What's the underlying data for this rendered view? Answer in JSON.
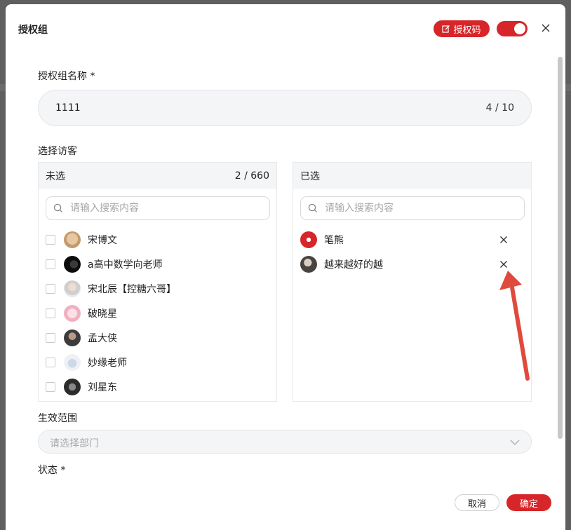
{
  "colors": {
    "accent": "#d6262a",
    "arrow": "#e04a3c"
  },
  "dialog": {
    "title": "授权组",
    "code_button_label": "授权码",
    "toggle_on": true
  },
  "form": {
    "name_label": "授权组名称 *",
    "name_value": "1111",
    "name_count": "4 / 10",
    "visitor_label": "选择访客",
    "scope_label": "生效范围",
    "scope_placeholder": "请选择部门",
    "status_label": "状态 *"
  },
  "unselected": {
    "title": "未选",
    "count": "2 / 660",
    "search_placeholder": "请输入搜索内容",
    "items": [
      {
        "name": "宋博文",
        "avatar": "bear-avatar"
      },
      {
        "name": "a高中数学向老师",
        "avatar": "dark-avatar"
      },
      {
        "name": "宋北辰【控糖六哥】",
        "avatar": "man-avatar"
      },
      {
        "name": "破晓星",
        "avatar": "pink-character-avatar"
      },
      {
        "name": "孟大侠",
        "avatar": "man-avatar"
      },
      {
        "name": "妙缘老师",
        "avatar": "statue-avatar"
      },
      {
        "name": "刘星东",
        "avatar": "group-avatar"
      }
    ]
  },
  "selected": {
    "title": "已选",
    "search_placeholder": "请输入搜索内容",
    "items": [
      {
        "name": "笔熊",
        "avatar": "red-bear-logo-avatar"
      },
      {
        "name": "越来越好的越",
        "avatar": "woman-avatar"
      }
    ]
  },
  "footer": {
    "cancel_label": "取消",
    "ok_label": "确定"
  }
}
